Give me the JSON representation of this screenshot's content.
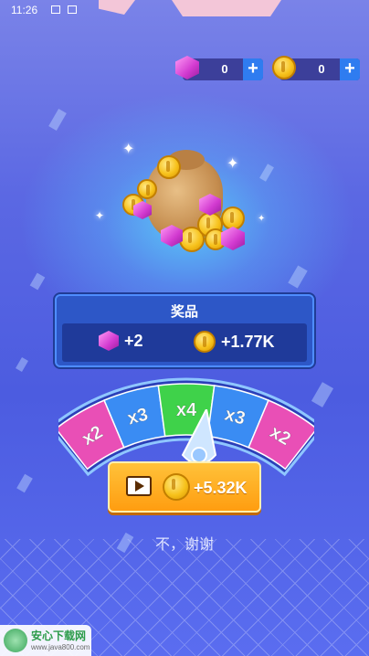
{
  "status_bar": {
    "time": "11:26"
  },
  "currencies": {
    "gems": {
      "value": "0",
      "icon": "gem-icon",
      "plus": "+"
    },
    "coins": {
      "value": "0",
      "icon": "coin-icon",
      "plus": "+"
    }
  },
  "prize": {
    "title": "奖品",
    "gem_reward": "+2",
    "coin_reward": "+1.77K"
  },
  "multiplier_wheel": {
    "segments": [
      {
        "label": "x2",
        "color": "#e94fb6"
      },
      {
        "label": "x3",
        "color": "#3a8cf3"
      },
      {
        "label": "x4",
        "color": "#3fd24a"
      },
      {
        "label": "x3",
        "color": "#3a8cf3"
      },
      {
        "label": "x2",
        "color": "#e94fb6"
      }
    ]
  },
  "claim_button": {
    "amount": "+5.32K",
    "icon": "video-icon"
  },
  "decline_text": "不，谢谢",
  "watermark": {
    "name": "安心下载网",
    "url": "www.java800.com"
  },
  "colors": {
    "accent_orange": "#ff9d10",
    "panel_blue": "#2d57c7",
    "plus_blue": "#2f7cf0"
  }
}
